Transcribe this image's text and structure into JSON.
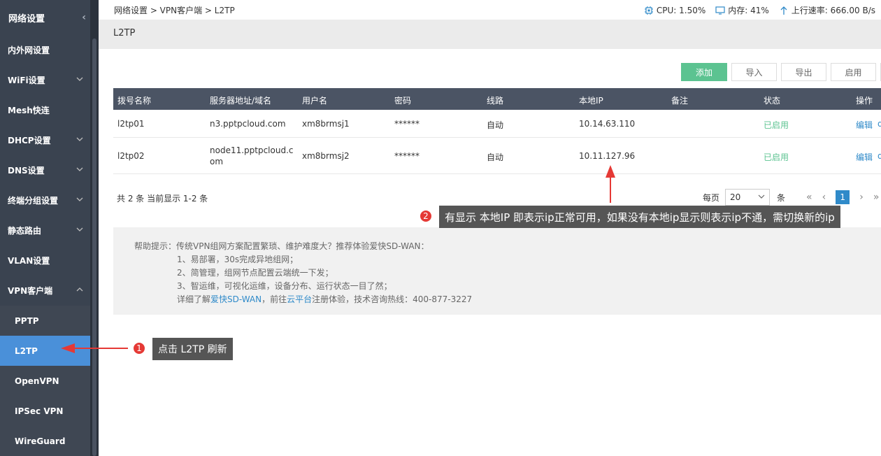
{
  "sidebar": {
    "title": "网络设置",
    "items": [
      {
        "label": "内外网设置",
        "has_caret": false
      },
      {
        "label": "WiFi设置",
        "has_caret": true
      },
      {
        "label": "Mesh快连",
        "has_caret": false
      },
      {
        "label": "DHCP设置",
        "has_caret": true
      },
      {
        "label": "DNS设置",
        "has_caret": true
      },
      {
        "label": "终端分组设置",
        "has_caret": true
      },
      {
        "label": "静态路由",
        "has_caret": true
      },
      {
        "label": "VLAN设置",
        "has_caret": false
      },
      {
        "label": "VPN客户端",
        "has_caret": true
      }
    ],
    "sub_items": [
      {
        "label": "PPTP"
      },
      {
        "label": "L2TP",
        "active": true
      },
      {
        "label": "OpenVPN"
      },
      {
        "label": "IPSec VPN"
      },
      {
        "label": "WireGuard"
      }
    ]
  },
  "topbar": {
    "breadcrumb": "网络设置 > VPN客户端 > L2TP",
    "cpu": "CPU: 1.50%",
    "memory": "内存: 41%",
    "upload": "上行速率: 666.00 B/s"
  },
  "page_title": "L2TP",
  "toolbar": {
    "add": "添加",
    "import": "导入",
    "export": "导出",
    "enable": "启用"
  },
  "table": {
    "headers": [
      "拨号名称",
      "服务器地址/域名",
      "用户名",
      "密码",
      "线路",
      "本地IP",
      "备注",
      "状态",
      "操作"
    ],
    "rows": [
      {
        "name": "l2tp01",
        "server": "n3.pptpcloud.com",
        "server2": "",
        "user": "xm8brmsj1",
        "password": "******",
        "line": "自动",
        "local_ip": "10.14.63.110",
        "note": "",
        "status": "已启用",
        "action": "编辑",
        "action2": "d"
      },
      {
        "name": "l2tp02",
        "server": "node11.pptpcloud.c",
        "server2": "om",
        "user": "xm8brmsj2",
        "password": "******",
        "line": "自动",
        "local_ip": "10.11.127.96",
        "note": "",
        "status": "已启用",
        "action": "编辑",
        "action2": "d"
      }
    ]
  },
  "footer": {
    "count": "共 2 条 当前显示 1-2 条",
    "per_page": "每页",
    "page_size": "20",
    "unit": "条",
    "current_page": "1"
  },
  "help": {
    "intro": "帮助提示：传统VPN组网方案配置繁琐、维护难度大？推荐体验爱快SD-WAN：",
    "point1": "1、易部署，30s完成异地组网；",
    "point2": "2、简管理，组网节点配置云端统一下发；",
    "point3": "3、智运维，可视化运维，设备分布、运行状态一目了然；",
    "more_prefix": "详细了解",
    "sdwan_link": "爱快SD-WAN",
    "more_mid": "，前往",
    "cloud_link": "云平台",
    "more_suffix": "注册体验，技术咨询热线：400-877-3227"
  },
  "annotations": {
    "note1_num": "1",
    "note1_text": "点击 L2TP 刷新",
    "note2_num": "2",
    "note2_text": "有显示 本地IP 即表示ip正常可用，如果没有本地ip显示则表示ip不通，需切换新的ip"
  },
  "colors": {
    "sidebar_bg": "#3a4350",
    "active": "#4a90d9",
    "primary_button": "#5cc391",
    "table_header": "#4b5464",
    "annotation_red": "#e53935"
  }
}
